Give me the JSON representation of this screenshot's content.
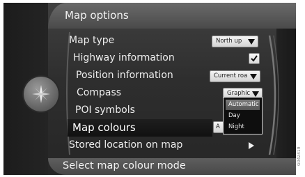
{
  "header": {
    "title": "Map options"
  },
  "menu": {
    "items": [
      {
        "label": "Map type",
        "control": "North up"
      },
      {
        "label": "Highway information",
        "checked": true
      },
      {
        "label": "Position information",
        "control": "Current roa"
      },
      {
        "label": "Compass",
        "control": "Graphic"
      },
      {
        "label": "POI symbols"
      },
      {
        "label": "Map colours",
        "control": "A",
        "selected": true
      },
      {
        "label": "Stored location on map"
      }
    ]
  },
  "dropdown": {
    "options": [
      "Automatic",
      "Day",
      "Night"
    ],
    "highlighted": "Automatic"
  },
  "footer": {
    "text": "Select map colour mode"
  },
  "image_code": "G042419",
  "icons": {
    "badge": "compass-rose-icon",
    "check": "checkmark-icon",
    "dropdown": "triangle-down-icon",
    "submenu": "arrow-right-icon"
  }
}
